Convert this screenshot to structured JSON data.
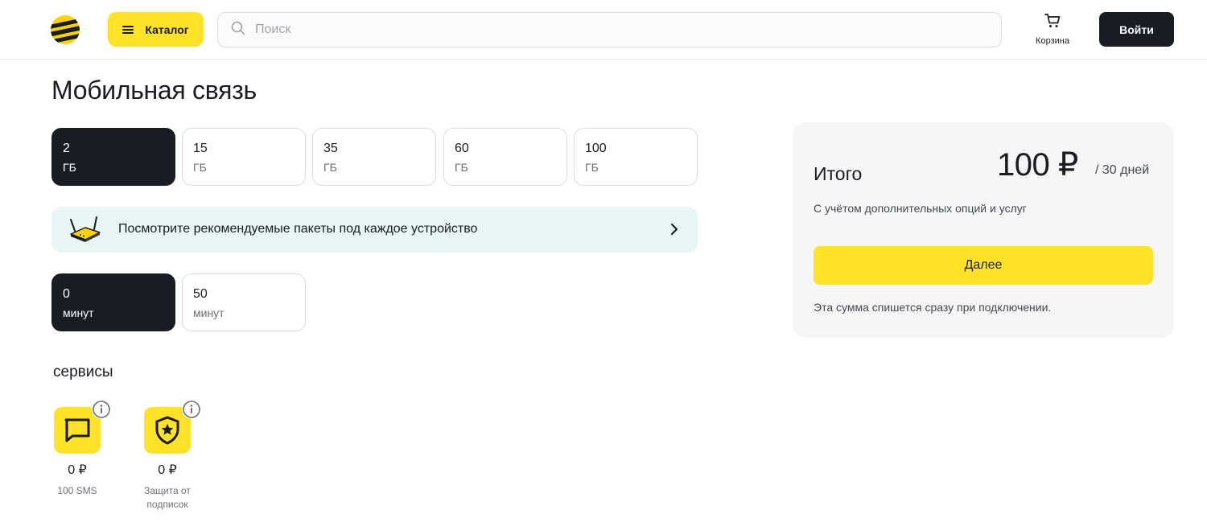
{
  "header": {
    "catalog_label": "Каталог",
    "search_placeholder": "Поиск",
    "cart_label": "Корзина",
    "login_label": "Войти"
  },
  "page": {
    "title": "Мобильная связь"
  },
  "data_options": [
    {
      "value": "2",
      "unit": "ГБ",
      "selected": true
    },
    {
      "value": "15",
      "unit": "ГБ",
      "selected": false
    },
    {
      "value": "35",
      "unit": "ГБ",
      "selected": false
    },
    {
      "value": "60",
      "unit": "ГБ",
      "selected": false
    },
    {
      "value": "100",
      "unit": "ГБ",
      "selected": false
    }
  ],
  "banner": {
    "text": "Посмотрите рекомендуемые пакеты под каждое устройство"
  },
  "minute_options": [
    {
      "value": "0",
      "unit": "минут",
      "selected": true
    },
    {
      "value": "50",
      "unit": "минут",
      "selected": false
    }
  ],
  "services": {
    "title": "сервисы",
    "items": [
      {
        "price": "0 ₽",
        "name": "100 SMS",
        "icon": "chat-bubble-icon"
      },
      {
        "price": "0 ₽",
        "name": "Защита от подписок",
        "icon": "shield-star-icon"
      }
    ]
  },
  "summary": {
    "title": "Итого",
    "price": "100 ₽",
    "period": "/ 30 дней",
    "note": "С учётом дополнительных опций и услуг",
    "next_label": "Далее",
    "footnote": "Эта сумма спишется сразу при подключении."
  },
  "colors": {
    "accent": "#ffe329",
    "dark": "#191c22",
    "banner_bg": "#e8f6f5",
    "panel_bg": "#f6f6f6"
  }
}
